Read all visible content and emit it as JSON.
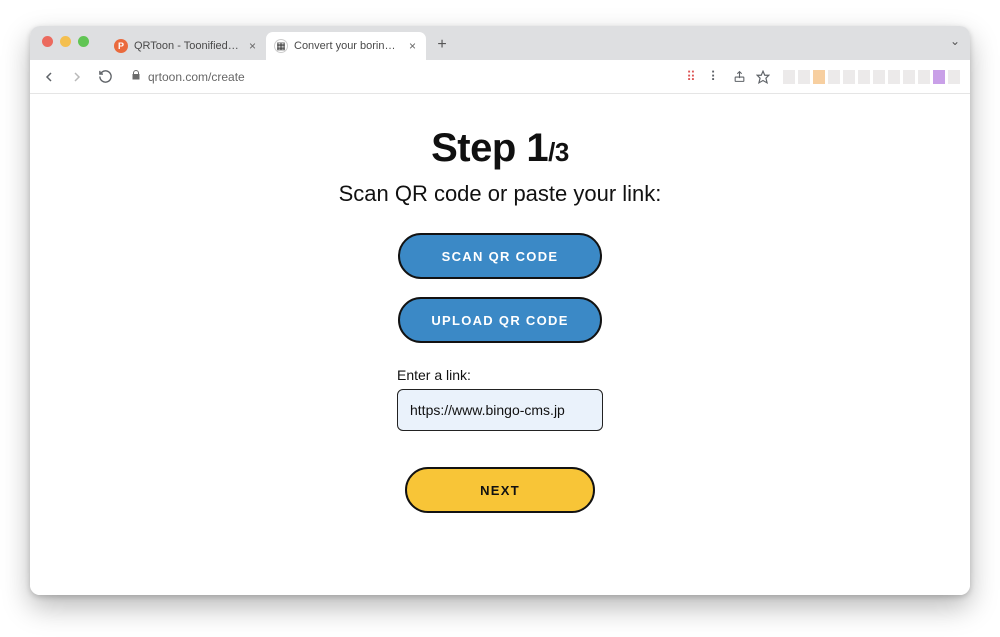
{
  "browser": {
    "tabs": [
      {
        "title": "QRToon - Toonified QR Maker",
        "active": false,
        "favicon_bg": "#ea6a3d",
        "favicon_text": "P",
        "favicon_color": "#fff"
      },
      {
        "title": "Convert your boring QR codes",
        "active": true,
        "favicon_bg": "#ffffff",
        "favicon_text": "▦",
        "favicon_color": "#333"
      }
    ],
    "address": "qrtoon.com/create",
    "expand_caret": "⌄"
  },
  "page": {
    "step_label": "Step 1",
    "step_total": "/3",
    "subtitle": "Scan QR code or paste your link:",
    "scan_button": "SCAN QR CODE",
    "upload_button": "UPLOAD QR CODE",
    "link_label": "Enter a link:",
    "link_value": "https://www.bingo-cms.jp",
    "next_button": "NEXT"
  },
  "colors": {
    "primary_blue": "#3b89c6",
    "accent_yellow": "#f8c537",
    "input_bg": "#eaf2fb"
  }
}
